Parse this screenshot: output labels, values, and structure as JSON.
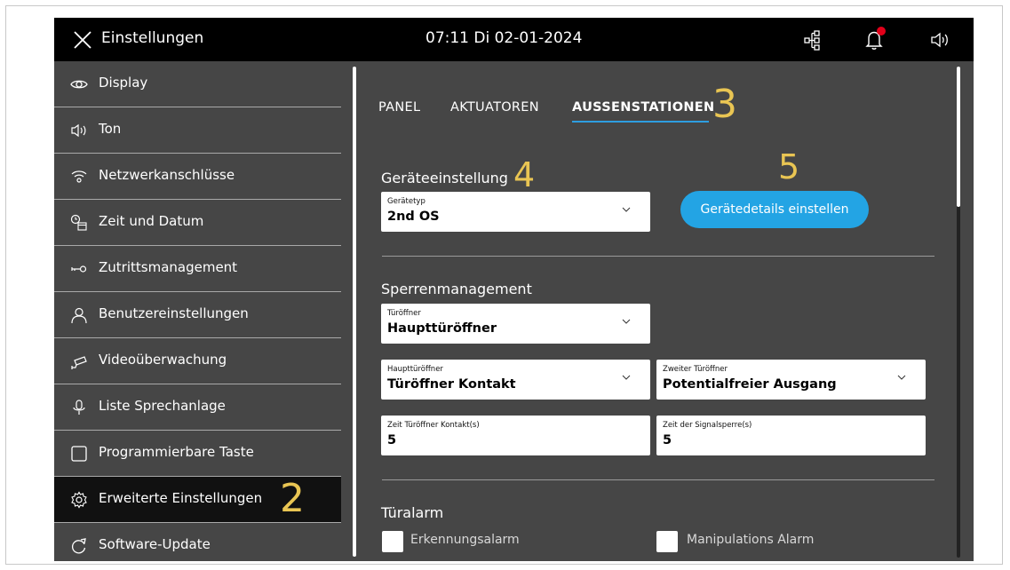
{
  "header": {
    "title": "Einstellungen",
    "datetime": "07:11  Di 02-01-2024",
    "icons": [
      "close-icon",
      "network-topology-icon",
      "notification-bell-icon",
      "speaker-icon"
    ],
    "notification_dot_color": "#e2001a"
  },
  "sidebar": {
    "items": [
      {
        "label": "Display",
        "icon": "eye-icon"
      },
      {
        "label": "Ton",
        "icon": "speaker-icon"
      },
      {
        "label": "Netzwerkanschlüsse",
        "icon": "wifi-icon"
      },
      {
        "label": "Zeit und Datum",
        "icon": "clock-calendar-icon"
      },
      {
        "label": "Zutrittsmanagement",
        "icon": "key-icon"
      },
      {
        "label": "Benutzereinstellungen",
        "icon": "user-icon"
      },
      {
        "label": "Videoüberwachung",
        "icon": "camera-icon"
      },
      {
        "label": "Liste Sprechanlage",
        "icon": "microphone-icon"
      },
      {
        "label": "Programmierbare Taste",
        "icon": "square-button-icon"
      },
      {
        "label": "Erweiterte Einstellungen",
        "icon": "gear-icon"
      },
      {
        "label": "Software-Update",
        "icon": "refresh-icon"
      }
    ],
    "active_index": 9
  },
  "callouts": {
    "sidebar": "2",
    "tab": "3",
    "section": "4",
    "button": "5",
    "color": "#e9c553"
  },
  "tabs": {
    "items": [
      "PANEL",
      "AKTUATOREN",
      "AUSSENSTATIONEN"
    ],
    "active_index": 2,
    "accent_color": "#2e9ee0"
  },
  "device_section": {
    "title": "Geräteeinstellung",
    "device_type": {
      "label": "Gerätetyp",
      "value": "2nd OS"
    },
    "details_button": "Gerätedetails einstellen"
  },
  "lock_section": {
    "title": "Sperrenmanagement",
    "door_opener": {
      "label": "Türöffner",
      "value": "Haupttüröffner"
    },
    "main_opener": {
      "label": "Haupttüröffner",
      "value": "Türöffner Kontakt"
    },
    "second_opener": {
      "label": "Zweiter Türöffner",
      "value": "Potentialfreier Ausgang"
    },
    "contact_time": {
      "label": "Zeit Türöffner Kontakt(s)",
      "value": "5"
    },
    "signal_lock_time": {
      "label": "Zeit der Signalsperre(s)",
      "value": "5"
    }
  },
  "alarm_section": {
    "title": "Türalarm",
    "detection_alarm": {
      "label": "Erkennungsalarm",
      "checked": false
    },
    "tamper_alarm": {
      "label": "Manipulations Alarm",
      "checked": false
    }
  }
}
